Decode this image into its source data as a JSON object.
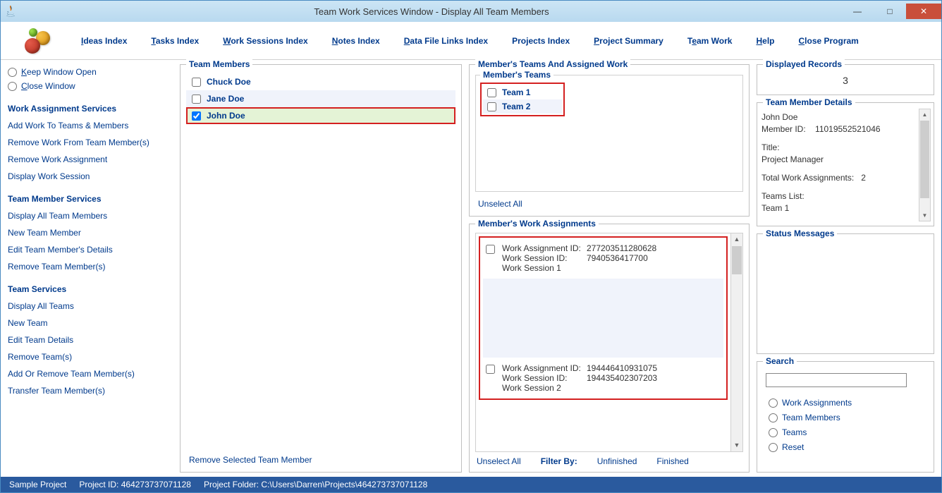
{
  "window": {
    "title": "Team Work Services Window - Display All Team Members"
  },
  "menu": {
    "ideas": "Ideas Index",
    "tasks": "Tasks Index",
    "work_sessions": "Work Sessions Index",
    "notes": "Notes Index",
    "data_links": "Data File Links Index",
    "projects": "Projects Index",
    "summary": "Project Summary",
    "team_work": "Team Work",
    "help": "Help",
    "close": "Close Program"
  },
  "sidebar": {
    "keep": "Keep Window Open",
    "close": "Close Window",
    "was_head": "Work Assignment Services",
    "was": [
      "Add Work To Teams & Members",
      "Remove Work From Team Member(s)",
      "Remove Work Assignment",
      "Display Work Session"
    ],
    "tms_head": "Team Member Services",
    "tms": [
      "Display All Team Members",
      "New Team Member",
      "Edit Team Member's Details",
      "Remove Team Member(s)"
    ],
    "ts_head": "Team Services",
    "ts": [
      "Display All Teams",
      "New Team",
      "Edit Team Details",
      "Remove Team(s)",
      "Add Or Remove Team Member(s)",
      "Transfer Team Member(s)"
    ]
  },
  "team_members": {
    "legend": "Team Members",
    "rows": [
      {
        "name": "Chuck Doe",
        "checked": false
      },
      {
        "name": "Jane Doe",
        "checked": false
      },
      {
        "name": "John Doe",
        "checked": true
      }
    ],
    "remove": "Remove Selected Team Member"
  },
  "mid": {
    "legend_outer": "Member's Teams And Assigned Work",
    "legend_inner": "Member's Teams",
    "teams": [
      "Team 1",
      "Team 2"
    ],
    "unselect": "Unselect All",
    "work_legend": "Member's Work Assignments",
    "assignments": [
      {
        "wa_id": "277203511280628",
        "ws_id": "7940536417700",
        "ws": "Work Session 1"
      },
      {
        "wa_id": "194446410931075",
        "ws_id": "194435402307203",
        "ws": "Work Session 2"
      }
    ],
    "wa_lbl": "Work Assignment ID:",
    "ws_lbl": "Work Session ID:",
    "filter_by": "Filter By:",
    "unfinished": "Unfinished",
    "finished": "Finished"
  },
  "right": {
    "disp_legend": "Displayed Records",
    "disp_count": "3",
    "details_legend": "Team Member Details",
    "details": {
      "name": "John Doe",
      "member_id_lbl": "Member ID:",
      "member_id": "11019552521046",
      "title_lbl": "Title:",
      "title": "Project Manager",
      "twa_lbl": "Total Work Assignments:",
      "twa": "2",
      "teams_lbl": "Teams List:",
      "team1": "Team 1"
    },
    "status_legend": "Status Messages",
    "search_legend": "Search",
    "search_opts": [
      "Work Assignments",
      "Team Members",
      "Teams",
      "Reset"
    ]
  },
  "status": {
    "project": "Sample Project",
    "pid_lbl": "Project ID:",
    "pid": "464273737071128",
    "folder_lbl": "Project Folder:",
    "folder": "C:\\Users\\Darren\\Projects\\464273737071128"
  }
}
